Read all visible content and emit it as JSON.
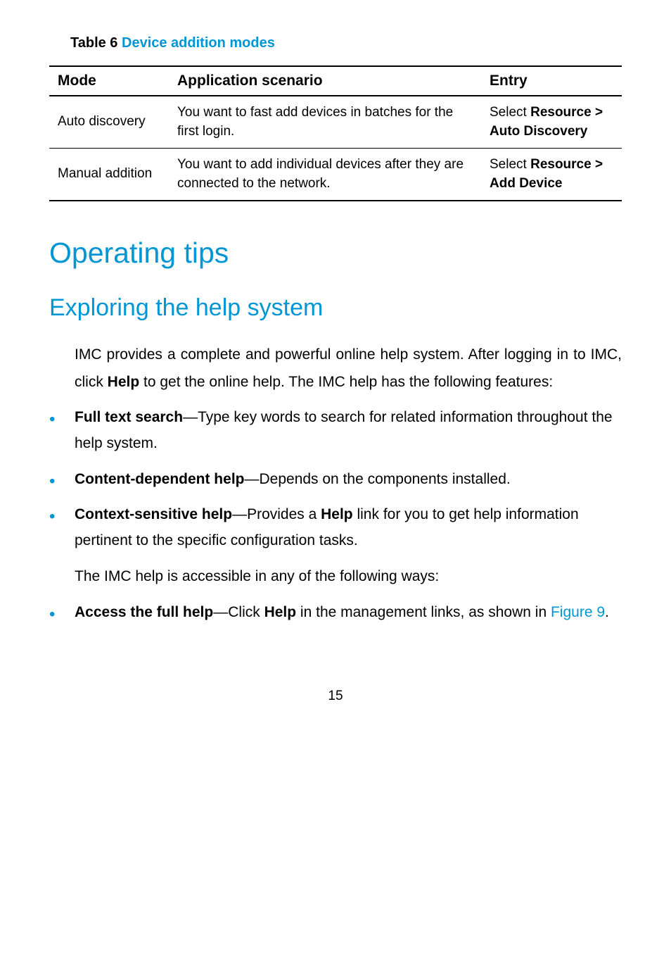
{
  "table": {
    "caption_label": "Table 6 ",
    "caption_title": "Device addition modes",
    "headers": {
      "mode": "Mode",
      "scenario": "Application scenario",
      "entry": "Entry"
    },
    "rows": [
      {
        "mode": "Auto discovery",
        "scenario": "You want to fast add devices in batches for the first login.",
        "entry_prefix": "Select ",
        "entry_bold": "Resource > Auto Discovery"
      },
      {
        "mode": "Manual addition",
        "scenario": "You want to add individual devices after they are connected to the network.",
        "entry_prefix": "Select ",
        "entry_bold": "Resource > Add Device"
      }
    ]
  },
  "h1": "Operating tips",
  "h2": "Exploring the help system",
  "intro_prefix": "IMC provides a complete and powerful online help system. After logging in to IMC, click ",
  "intro_bold": "Help",
  "intro_suffix": " to get the online help. The IMC help has the following features:",
  "bullets1": [
    {
      "bold": "Full text search",
      "text": "—Type key words to search for related information throughout the help system."
    },
    {
      "bold": "Content-dependent help",
      "text": "—Depends on the components installed."
    },
    {
      "bold": "Context-sensitive help",
      "text_prefix": "—Provides a ",
      "text_bold": "Help",
      "text_suffix": " link for you to get help information pertinent to the specific configuration tasks."
    }
  ],
  "mid_text": "The IMC help is accessible in any of the following ways:",
  "bullets2": [
    {
      "bold": "Access the full help",
      "text_prefix": "—Click ",
      "text_bold": "Help",
      "text_suffix": " in the management links, as shown in ",
      "link": "Figure 9",
      "tail": "."
    }
  ],
  "page_number": "15"
}
